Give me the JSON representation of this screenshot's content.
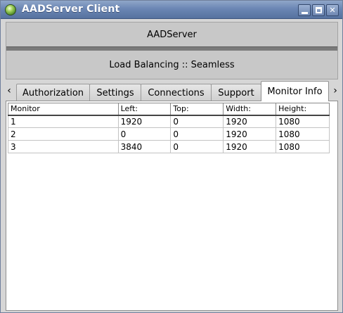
{
  "window": {
    "title": "AADServer Client",
    "controls": {
      "minimize": "",
      "maximize": "",
      "close": "✕"
    }
  },
  "banner": {
    "server_name": "AADServer",
    "mode": "Load Balancing :: Seamless"
  },
  "tabs": {
    "scroll_left": "‹",
    "scroll_right": "›",
    "items": [
      {
        "label": "Authorization"
      },
      {
        "label": "Settings"
      },
      {
        "label": "Connections"
      },
      {
        "label": "Support"
      },
      {
        "label": "Monitor Info"
      }
    ],
    "active": "Monitor Info"
  },
  "monitor_table": {
    "headers": [
      "Monitor",
      "Left:",
      "Top:",
      "Width:",
      "Height:"
    ],
    "rows": [
      [
        "1",
        "1920",
        "0",
        "1920",
        "1080"
      ],
      [
        "2",
        "0",
        "0",
        "1920",
        "1080"
      ],
      [
        "3",
        "3840",
        "0",
        "1920",
        "1080"
      ]
    ]
  },
  "colors": {
    "titlebar": "#6b86b4",
    "window_bg": "#d6d6d6",
    "banner_bg": "#c8c8c8",
    "panel_bg": "#ffffff"
  }
}
